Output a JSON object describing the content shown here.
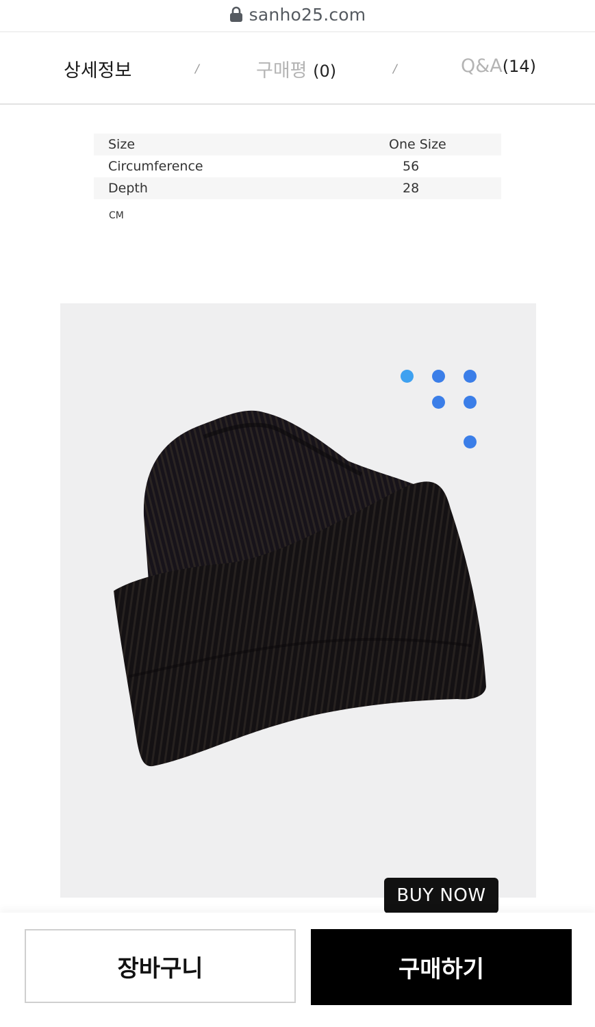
{
  "browser": {
    "url": "sanho25.com",
    "lock_icon": "lock-icon"
  },
  "tabs": [
    {
      "label": "상세정보",
      "count": ""
    },
    {
      "label": "구매평",
      "count": "(0)"
    },
    {
      "label": "Q&A",
      "count": "(14)"
    }
  ],
  "tab_separator": "/",
  "size_table": {
    "header": {
      "label": "Size",
      "value": "One Size"
    },
    "rows": [
      {
        "label": "Circumference",
        "value": "56"
      },
      {
        "label": "Depth",
        "value": "28"
      }
    ],
    "unit": "CM"
  },
  "product_image": {
    "description_icon": "black-knit-beanie-image",
    "background": "#efeff0",
    "dot_color": "#3b7ee8"
  },
  "actions": {
    "cart_label": "장바구니",
    "buy_label": "구매하기",
    "tooltip_label": "BUY NOW"
  }
}
